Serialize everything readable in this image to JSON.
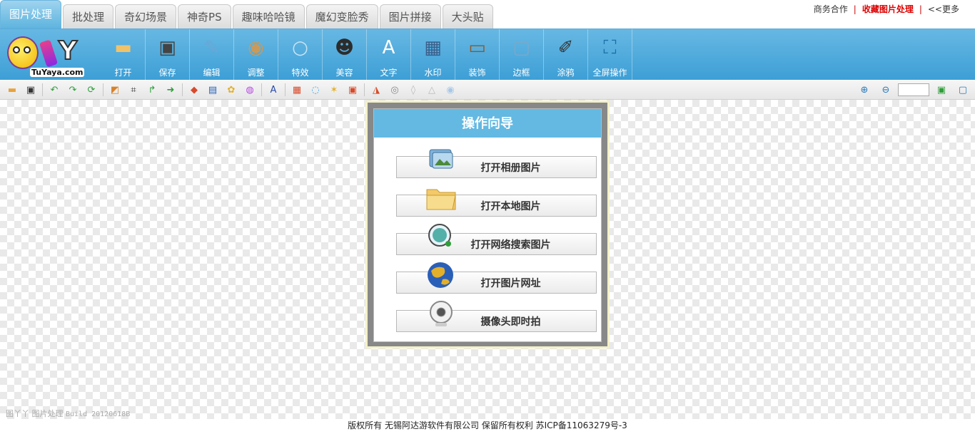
{
  "tabs": [
    {
      "label": "图片处理",
      "active": true
    },
    {
      "label": "批处理"
    },
    {
      "label": "奇幻场景"
    },
    {
      "label": "神奇PS"
    },
    {
      "label": "趣味哈哈镜"
    },
    {
      "label": "魔幻变脸秀"
    },
    {
      "label": "图片拼接"
    },
    {
      "label": "大头贴"
    }
  ],
  "toplinks": {
    "business": "商务合作",
    "favorite": "收藏图片处理",
    "more": "<<更多",
    "separator": "|"
  },
  "logo": {
    "site": "TuYaya.com",
    "mark": "Y"
  },
  "tools": [
    {
      "label": "打开",
      "icon": "folder-icon",
      "color": "#f0c36a",
      "glyph": "▬"
    },
    {
      "label": "保存",
      "icon": "floppy-disk-icon",
      "color": "#444444",
      "glyph": "▣"
    },
    {
      "label": "编辑",
      "icon": "edit-pencil-icon",
      "color": "#6aa7d4",
      "glyph": "✎"
    },
    {
      "label": "调整",
      "icon": "palette-icon",
      "color": "#c99a5a",
      "glyph": "◉"
    },
    {
      "label": "特效",
      "icon": "magnifier-lens-icon",
      "color": "#c8e4f4",
      "glyph": "○"
    },
    {
      "label": "美容",
      "icon": "face-icon",
      "color": "#2c2c2c",
      "glyph": "☻"
    },
    {
      "label": "文字",
      "icon": "text-a-icon",
      "color": "#ffffff",
      "glyph": "A"
    },
    {
      "label": "水印",
      "icon": "watermark-icon",
      "color": "#3a5f8a",
      "glyph": "▦"
    },
    {
      "label": "装饰",
      "icon": "frame-decoration-icon",
      "color": "#8b5a2b",
      "glyph": "▭"
    },
    {
      "label": "边框",
      "icon": "border-frame-icon",
      "color": "#7aa9c9",
      "glyph": "▢"
    },
    {
      "label": "涂鸦",
      "icon": "brush-icon",
      "color": "#333333",
      "glyph": "✐"
    },
    {
      "label": "全屏操作",
      "icon": "fullscreen-icon",
      "color": "#1b6fa8",
      "glyph": "⛶"
    }
  ],
  "subtools": [
    {
      "icon": "open-folder-icon",
      "glyph": "▬",
      "color": "#e8a23c"
    },
    {
      "icon": "save-icon",
      "glyph": "▣",
      "color": "#333333"
    },
    {
      "sep": true
    },
    {
      "icon": "undo-icon",
      "glyph": "↶",
      "color": "#2f9e3a"
    },
    {
      "icon": "redo-icon",
      "glyph": "↷",
      "color": "#2f9e3a"
    },
    {
      "icon": "refresh-icon",
      "glyph": "⟳",
      "color": "#2f9e3a"
    },
    {
      "sep": true
    },
    {
      "icon": "resize-icon",
      "glyph": "◩",
      "color": "#d8822a"
    },
    {
      "icon": "crop-icon",
      "glyph": "⌗",
      "color": "#333333"
    },
    {
      "icon": "rotate-icon",
      "glyph": "↱",
      "color": "#2f9e3a"
    },
    {
      "icon": "flip-icon",
      "glyph": "➜",
      "color": "#2f9e3a"
    },
    {
      "sep": true
    },
    {
      "icon": "layers-icon",
      "glyph": "◆",
      "color": "#d84a2a"
    },
    {
      "icon": "image-icon",
      "glyph": "▤",
      "color": "#2a62b8"
    },
    {
      "icon": "color-balance-icon",
      "glyph": "✿",
      "color": "#e2b02a"
    },
    {
      "icon": "color-wheel-icon",
      "glyph": "◍",
      "color": "#b84ae2"
    },
    {
      "sep": true
    },
    {
      "icon": "text-icon",
      "glyph": "A",
      "color": "#2a4aa8"
    },
    {
      "sep": true
    },
    {
      "icon": "palette-small-icon",
      "glyph": "▦",
      "color": "#d84a2a"
    },
    {
      "icon": "bulb-icon",
      "glyph": "◌",
      "color": "#3aa0e0"
    },
    {
      "icon": "sparkle-icon",
      "glyph": "✶",
      "color": "#e2b02a"
    },
    {
      "icon": "frame-small-icon",
      "glyph": "▣",
      "color": "#d84a2a"
    },
    {
      "sep": true
    },
    {
      "icon": "pen-tool-icon",
      "glyph": "◮",
      "color": "#d84a2a"
    },
    {
      "icon": "stamp-icon",
      "glyph": "◎",
      "color": "#888888"
    },
    {
      "icon": "drop-icon",
      "glyph": "◊",
      "color": "#bbbbbb"
    },
    {
      "icon": "triangle-icon",
      "glyph": "△",
      "color": "#bbbbbb"
    },
    {
      "icon": "circle-icon",
      "glyph": "◉",
      "color": "#a8c8e8"
    }
  ],
  "zoom": {
    "zoom_in_icon": "⊕",
    "zoom_out_icon": "⊖",
    "value": "",
    "fit_icon": "▣",
    "full_icon": "▢"
  },
  "guide": {
    "title": "操作向导",
    "buttons": [
      {
        "label": "打开相册图片",
        "icon": "album-photos-icon"
      },
      {
        "label": "打开本地图片",
        "icon": "local-folder-icon"
      },
      {
        "label": "打开网络搜索图片",
        "icon": "web-search-icon"
      },
      {
        "label": "打开图片网址",
        "icon": "globe-icon"
      },
      {
        "label": "摄像头即时拍",
        "icon": "webcam-icon"
      }
    ]
  },
  "build": {
    "name": "图丫丫 图片处理",
    "version": "Build 20120618B"
  },
  "footer": {
    "text": "版权所有  无锡阿达游软件有限公司  保留所有权利  苏ICP备11063279号-3"
  }
}
